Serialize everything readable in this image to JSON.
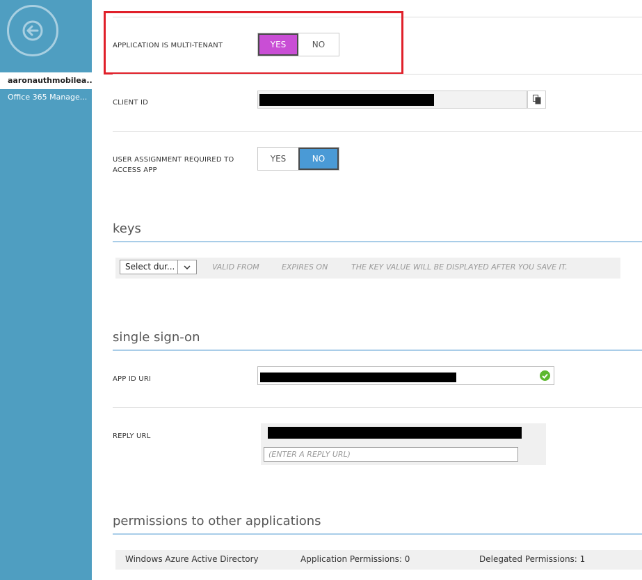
{
  "sidebar": {
    "back_icon": "arrow-left-icon",
    "items": [
      {
        "label": "aaronauthmobilea..."
      },
      {
        "label": "Office 365 Manage..."
      }
    ]
  },
  "multi_tenant": {
    "label": "APPLICATION IS MULTI-TENANT",
    "yes": "YES",
    "no": "NO",
    "selected": "YES"
  },
  "client_id": {
    "label": "CLIENT ID",
    "copy_icon": "copy-icon"
  },
  "user_assignment": {
    "label_line1": "USER ASSIGNMENT REQUIRED TO",
    "label_line2": "ACCESS APP",
    "yes": "YES",
    "no": "NO",
    "selected": "NO"
  },
  "keys": {
    "title": "keys",
    "duration_select": "Select dur...",
    "valid_from": "VALID FROM",
    "expires_on": "EXPIRES ON",
    "key_value_note": "THE KEY VALUE WILL BE DISPLAYED AFTER YOU SAVE IT."
  },
  "sso": {
    "title": "single sign-on",
    "app_id_uri_label": "APP ID URI",
    "reply_url_label": "REPLY URL",
    "reply_url_placeholder": "(ENTER A REPLY URL)"
  },
  "permissions": {
    "title": "permissions to other applications",
    "rows": [
      {
        "app": "Windows Azure Active Directory",
        "application_permissions": "Application Permissions: 0",
        "delegated_permissions": "Delegated Permissions: 1"
      }
    ]
  },
  "colors": {
    "sidebar": "#4f9ec1",
    "toggle_on_purple": "#c94ed5",
    "toggle_on_blue": "#4a9ad6",
    "highlight": "#e0202a",
    "success": "#5cb82e"
  }
}
